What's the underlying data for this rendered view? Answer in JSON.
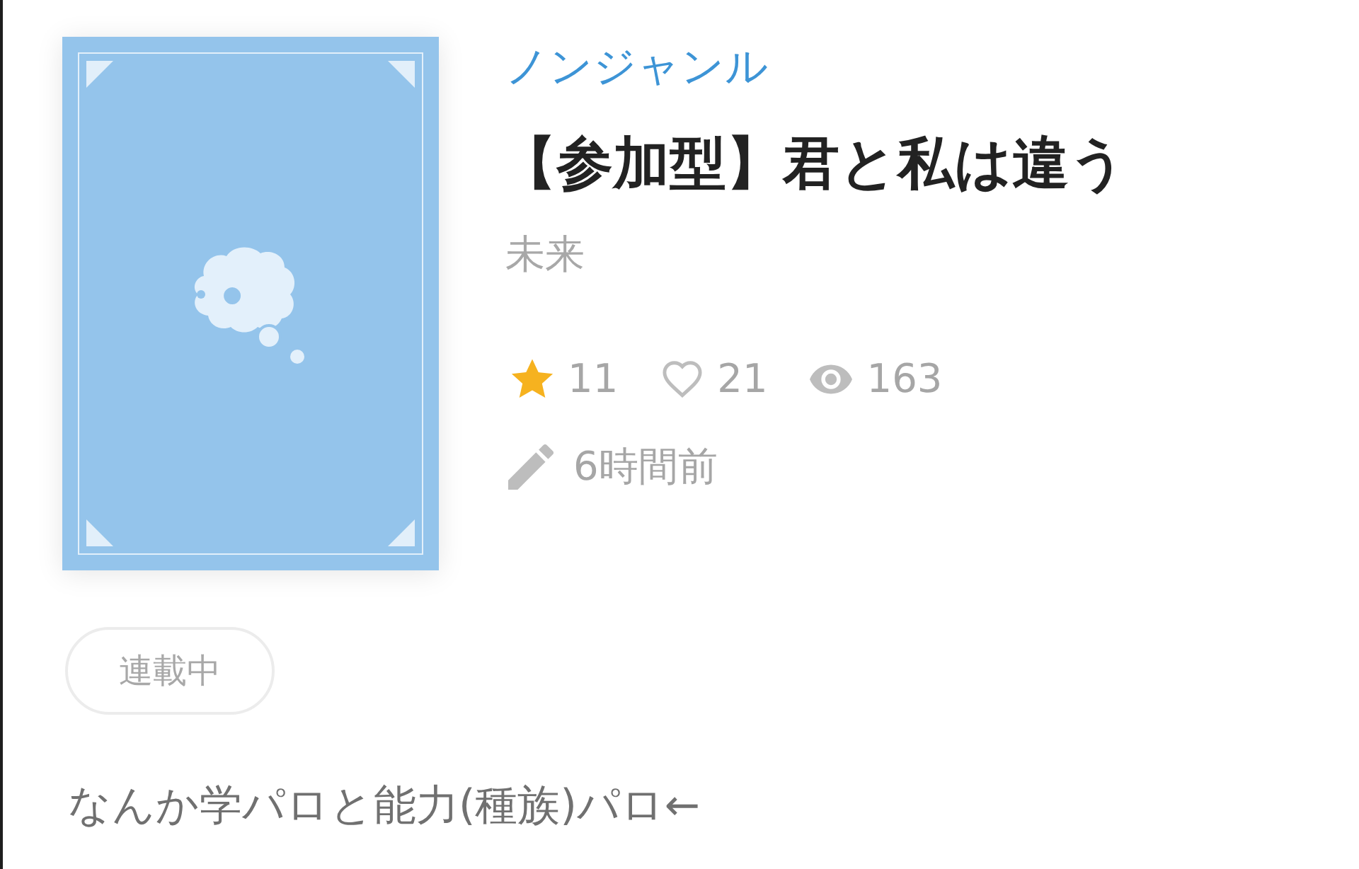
{
  "work": {
    "genre": "ノンジャンル",
    "title": "【参加型】君と私は違う",
    "author": "未来",
    "stats": [
      {
        "kind": "favorites",
        "count": "11"
      },
      {
        "kind": "likes",
        "count": "21"
      },
      {
        "kind": "views",
        "count": "163"
      }
    ],
    "updated": "6時間前"
  },
  "status_tag": "連載中",
  "description": "なんか学パロと能力(種族)パロ←"
}
